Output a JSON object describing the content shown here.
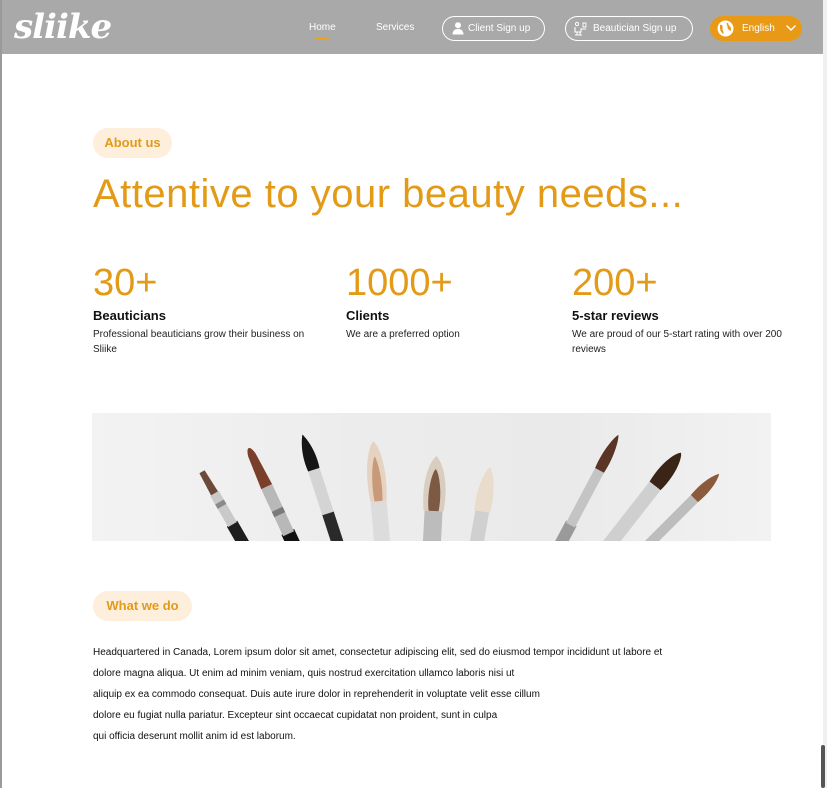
{
  "brand": {
    "logo_text": "sliike",
    "accent_color": "#e39a17",
    "badge_bg": "#fdefdc",
    "nav_bg": "#a9a9a9"
  },
  "nav": {
    "home": "Home",
    "services": "Services",
    "client_signup": "Client Sign up",
    "beautician_signup": "Beautician Sign up",
    "language": "English",
    "icons": {
      "client": "user-icon",
      "beautician": "beautician-chair-icon",
      "language": "globe-icon",
      "dropdown": "chevron-down-icon"
    }
  },
  "about": {
    "badge": "About us",
    "headline": "Attentive to your beauty needs...",
    "stats": [
      {
        "value": "30+",
        "title": "Beauticians",
        "desc": "Professional beauticians grow their business on Sliike"
      },
      {
        "value": "1000+",
        "title": "Clients",
        "desc": "We are a preferred option"
      },
      {
        "value": "200+",
        "title": "5-star reviews",
        "desc": "We are proud of our 5-start rating with over 200 reviews"
      }
    ]
  },
  "banner": {
    "image": "makeup-brushes-photo"
  },
  "what_we_do": {
    "badge": "What we do",
    "lines": [
      "Headquartered in Canada,  Lorem ipsum dolor sit amet, consectetur adipiscing elit, sed do eiusmod tempor incididunt ut labore et",
      "dolore magna aliqua. Ut enim ad minim veniam, quis nostrud exercitation ullamco laboris nisi ut",
      "aliquip ex ea commodo consequat. Duis aute irure dolor in reprehenderit in voluptate velit esse cillum",
      "dolore eu fugiat nulla pariatur. Excepteur sint occaecat cupidatat non proident, sunt in culpa",
      "qui officia deserunt mollit anim id est laborum."
    ]
  }
}
